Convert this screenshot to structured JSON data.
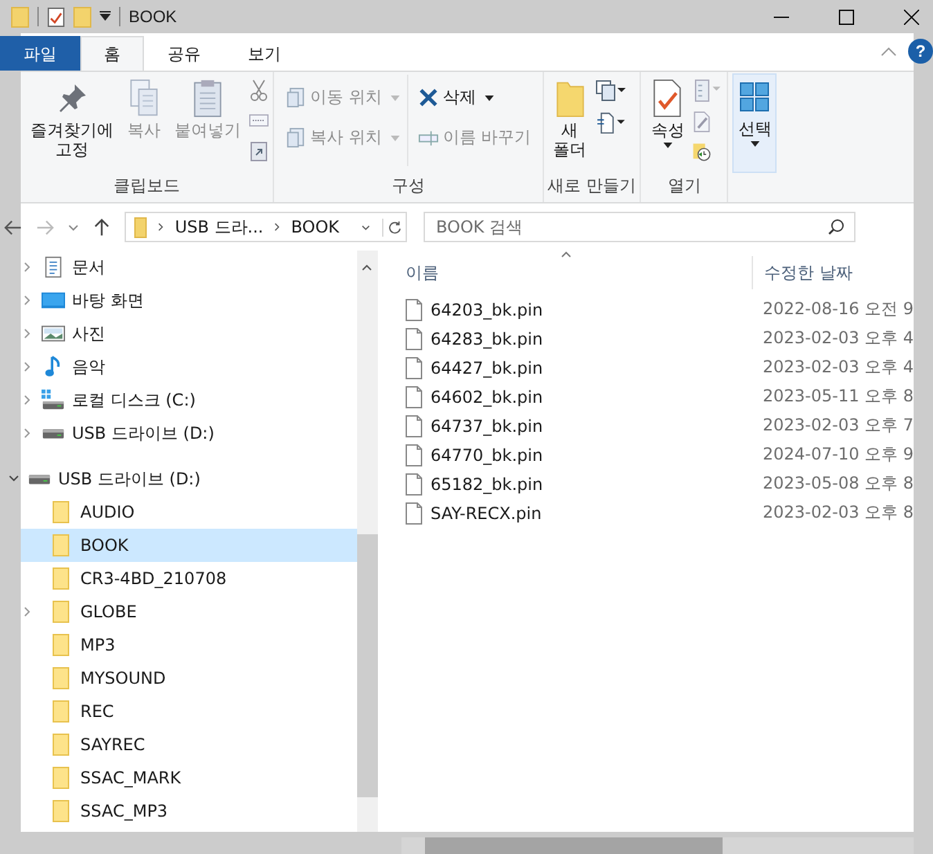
{
  "window": {
    "title": "BOOK"
  },
  "ribbon_tabs": [
    {
      "label": "파일",
      "kind": "file",
      "selected": false
    },
    {
      "label": "홈",
      "kind": "tab",
      "selected": true
    },
    {
      "label": "공유",
      "kind": "tab",
      "selected": false
    },
    {
      "label": "보기",
      "kind": "tab",
      "selected": false
    }
  ],
  "help": {
    "label": "?"
  },
  "ribbon_groups": [
    {
      "label": "클립보드",
      "buttons": [
        {
          "label": "즐겨찾기에\n고정",
          "kind": "pin",
          "disabled": false
        },
        {
          "label": "복사",
          "kind": "copy",
          "disabled": true
        },
        {
          "label": "붙여넣기",
          "kind": "paste",
          "disabled": true
        },
        {
          "kind": "small-stack"
        }
      ]
    },
    {
      "label": "구성",
      "buttons": [
        {
          "kind": "column",
          "items": [
            {
              "label": "이동 위치",
              "kind": "move",
              "disabled": true
            },
            {
              "label": "복사 위치",
              "kind": "copyto",
              "disabled": true
            }
          ]
        },
        {
          "kind": "column",
          "items": [
            {
              "label": "삭제",
              "kind": "delete",
              "disabled": false
            },
            {
              "label": "이름 바꾸기",
              "kind": "rename",
              "disabled": true
            }
          ]
        }
      ]
    },
    {
      "label": "새로 만들기",
      "buttons": [
        {
          "label": "새\n폴더",
          "kind": "folder",
          "disabled": false
        },
        {
          "kind": "new-stack"
        }
      ]
    },
    {
      "label": "열기",
      "buttons": [
        {
          "label": "속성",
          "kind": "props",
          "disabled": false
        },
        {
          "kind": "open-stack"
        }
      ]
    },
    {
      "buttons": [
        {
          "label": "선택",
          "kind": "select",
          "disabled": false
        }
      ]
    }
  ],
  "address": {
    "segments": [
      "USB 드라...",
      "BOOK"
    ]
  },
  "search": {
    "placeholder": "BOOK 검색"
  },
  "nav": [
    {
      "label": "문서",
      "kind": "documents",
      "expander": true,
      "selected": false
    },
    {
      "label": "바탕 화면",
      "kind": "desktop",
      "expander": true,
      "selected": false
    },
    {
      "label": "사진",
      "kind": "pictures",
      "expander": true,
      "selected": false
    },
    {
      "label": "음악",
      "kind": "music",
      "expander": true,
      "selected": false
    },
    {
      "label": "로컬 디스크 (C:)",
      "kind": "disk",
      "expander": true,
      "selected": false
    },
    {
      "label": "USB 드라이브 (D:)",
      "kind": "drive",
      "expander": true,
      "selected": false
    },
    {
      "label": "USB 드라이브 (D:)",
      "kind": "drive",
      "expander": true,
      "expanded": true,
      "selected": false,
      "children": [
        {
          "label": "AUDIO",
          "kind": "folder",
          "expander": false,
          "selected": false
        },
        {
          "label": "BOOK",
          "kind": "folder",
          "expander": false,
          "selected": true
        },
        {
          "label": "CR3-4BD_210708",
          "kind": "folder",
          "expander": false,
          "selected": false
        },
        {
          "label": "GLOBE",
          "kind": "folder",
          "expander": true,
          "selected": false
        },
        {
          "label": "MP3",
          "kind": "folder",
          "expander": false,
          "selected": false
        },
        {
          "label": "MYSOUND",
          "kind": "folder",
          "expander": false,
          "selected": false
        },
        {
          "label": "REC",
          "kind": "folder",
          "expander": false,
          "selected": false
        },
        {
          "label": "SAYREC",
          "kind": "folder",
          "expander": false,
          "selected": false
        },
        {
          "label": "SSAC_MARK",
          "kind": "folder",
          "expander": false,
          "selected": false
        },
        {
          "label": "SSAC_MP3",
          "kind": "folder",
          "expander": false,
          "selected": false
        }
      ]
    }
  ],
  "table": {
    "columns": [
      "이름",
      "수정한 날짜"
    ],
    "rows": [
      [
        "64203_bk.pin",
        "2022-08-16 오전 9"
      ],
      [
        "64283_bk.pin",
        "2023-02-03 오후 4"
      ],
      [
        "64427_bk.pin",
        "2023-02-03 오후 4"
      ],
      [
        "64602_bk.pin",
        "2023-05-11 오후 8"
      ],
      [
        "64737_bk.pin",
        "2023-02-03 오후 7"
      ],
      [
        "64770_bk.pin",
        "2024-07-10 오후 9"
      ],
      [
        "65182_bk.pin",
        "2023-05-08 오후 8"
      ],
      [
        "SAY-RECX.pin",
        "2023-02-03 오후 8"
      ]
    ]
  }
}
